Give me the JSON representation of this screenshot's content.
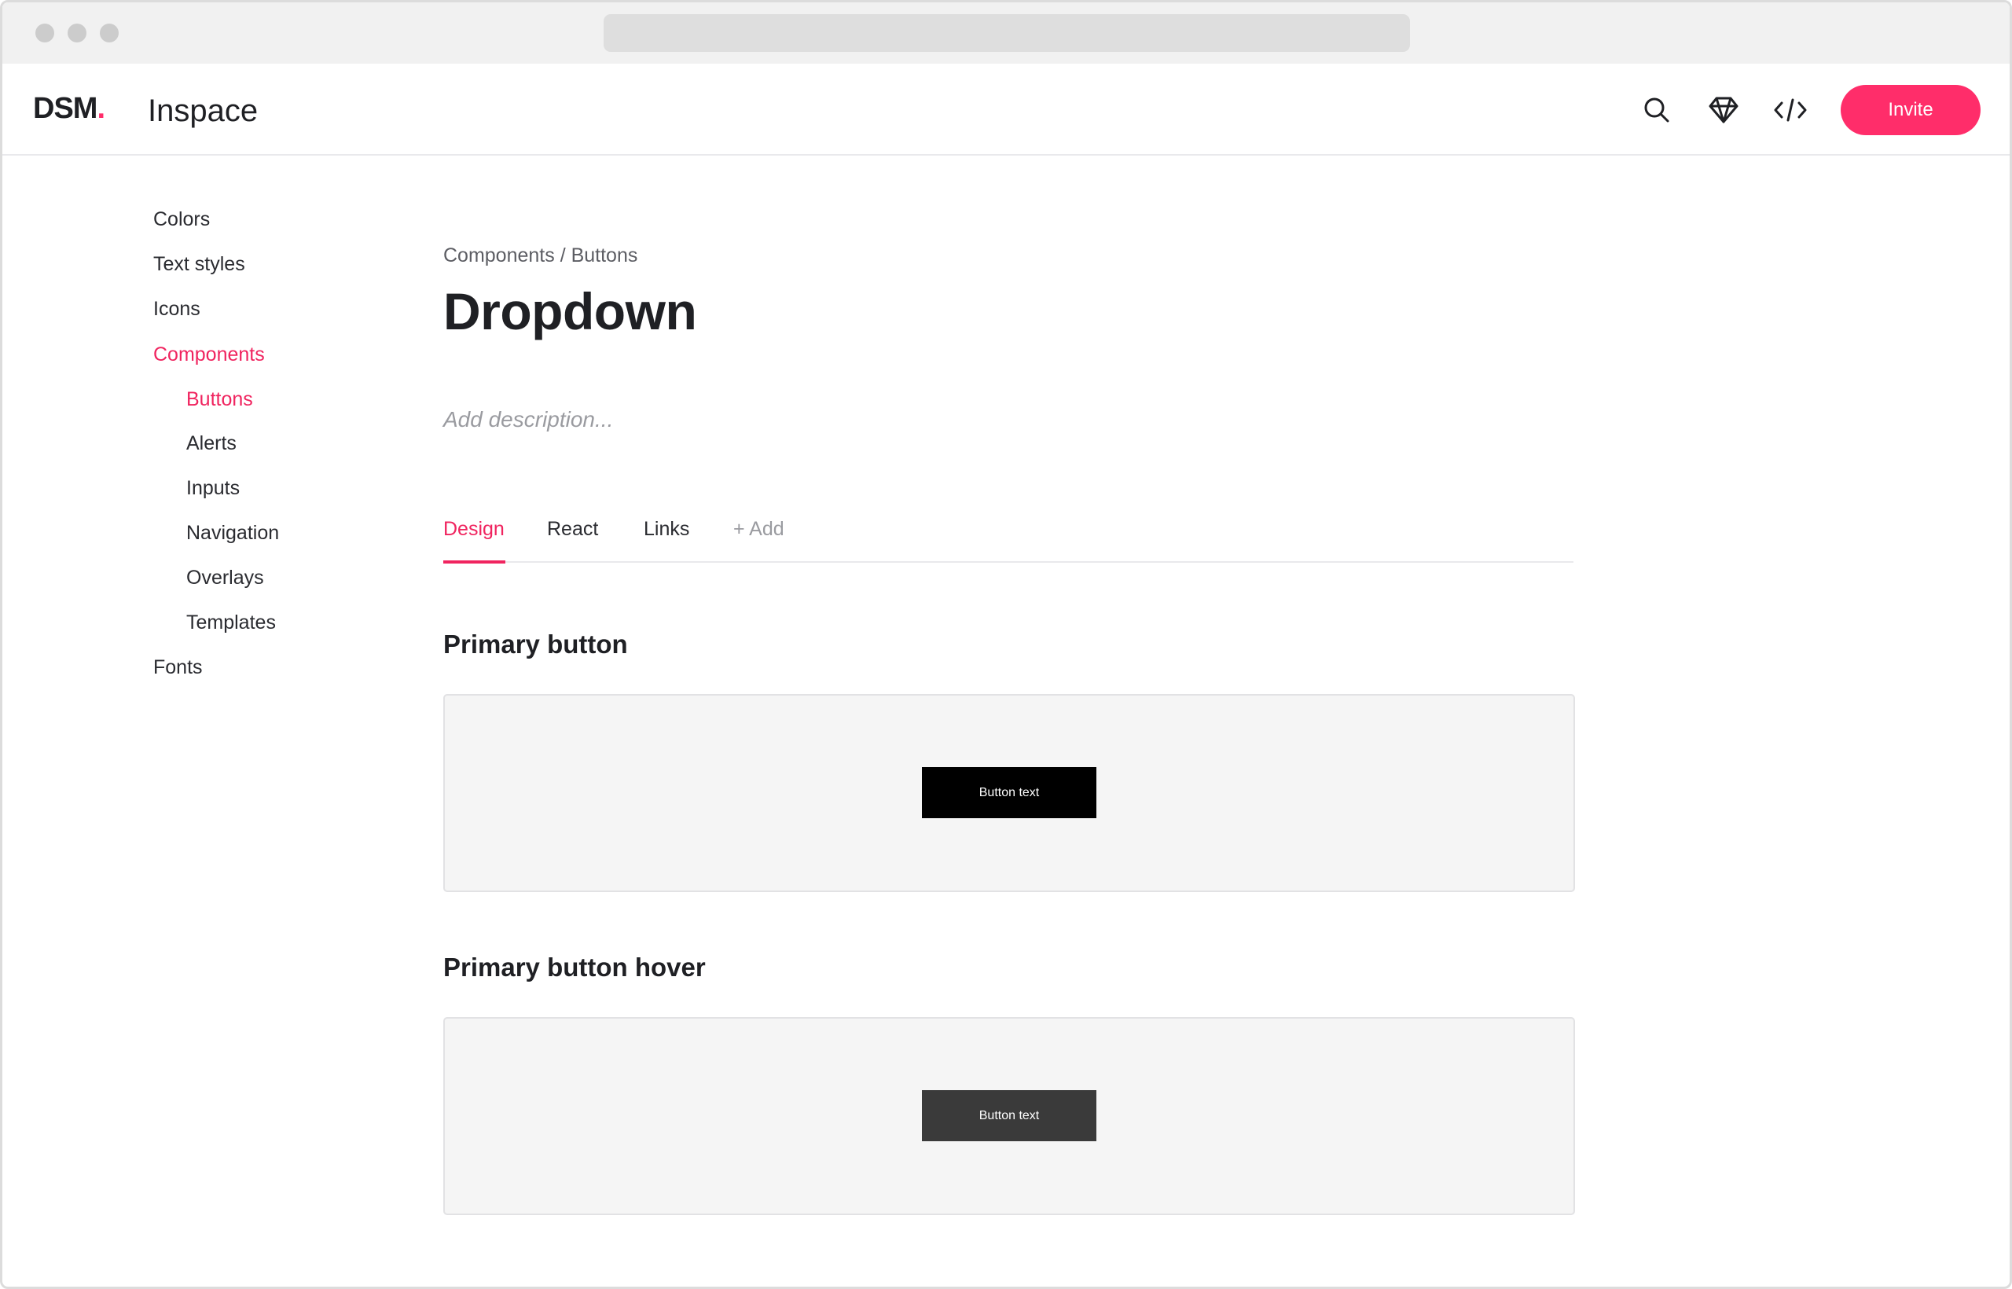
{
  "header": {
    "logo_text": "DSM",
    "logo_dot": ".",
    "workspace_name": "Inspace",
    "invite_label": "Invite",
    "icons": [
      "search-icon",
      "sketch-icon",
      "code-icon"
    ]
  },
  "sidebar": {
    "items": [
      {
        "label": "Colors",
        "active": false
      },
      {
        "label": "Text styles",
        "active": false
      },
      {
        "label": "Icons",
        "active": false
      },
      {
        "label": "Components",
        "active": true
      },
      {
        "label": "Buttons",
        "active": true,
        "child": true
      },
      {
        "label": "Alerts",
        "active": false,
        "child": true
      },
      {
        "label": "Inputs",
        "active": false,
        "child": true
      },
      {
        "label": "Navigation",
        "active": false,
        "child": true
      },
      {
        "label": "Overlays",
        "active": false,
        "child": true
      },
      {
        "label": "Templates",
        "active": false,
        "child": true
      },
      {
        "label": "Fonts",
        "active": false
      }
    ]
  },
  "main": {
    "breadcrumb": "Components / Buttons",
    "title": "Dropdown",
    "description_placeholder": "Add description...",
    "tabs": [
      {
        "label": "Design",
        "active": true
      },
      {
        "label": "React",
        "active": false
      },
      {
        "label": "Links",
        "active": false
      },
      {
        "label": "+ Add",
        "active": false
      }
    ],
    "sections": [
      {
        "heading": "Primary button",
        "button_text": "Button text",
        "button_color": "#000000"
      },
      {
        "heading": "Primary button hover",
        "button_text": "Button text",
        "button_color": "#3a3a3a"
      }
    ]
  },
  "colors": {
    "accent": "#ff2d6a",
    "active_text": "#f0245f"
  }
}
